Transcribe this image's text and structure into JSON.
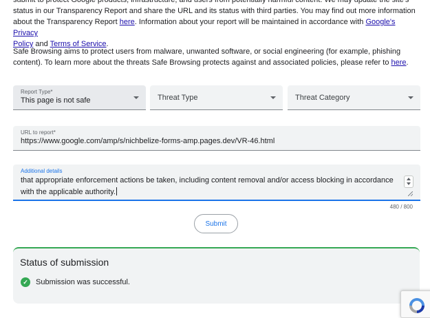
{
  "intro": {
    "line1": "submit to protect Google products, infrastructure, and users from potentially harmful content. We may update the site's",
    "line2": "status in our Transparency Report and share the URL and its status with third parties. You may find out more information",
    "line3_before": "about the Transparency Report ",
    "line3_link": "here",
    "line3_after": ". Information about your report will be maintained in accordance with ",
    "privacy_link_1": "Google's Privacy",
    "privacy_link_2": "Policy",
    "and": " and ",
    "terms_link": "Terms of Service",
    "period": "."
  },
  "safe_browsing": {
    "line1": "Safe Browsing aims to protect users from malware, unwanted software, or social engineering (for example, phishing",
    "line2_before": "content). To learn more about the threats Safe Browsing protects against and associated policies, please refer to ",
    "line2_link": "here",
    "line2_after": "."
  },
  "form": {
    "report_type_label": "Report Type*",
    "report_type_value": "This page is not safe",
    "threat_type_placeholder": "Threat Type",
    "threat_category_placeholder": "Threat Category",
    "url_label": "URL to report*",
    "url_value": "https://www.google.com/amp/s/nichbelize-forms-amp.pages.dev/VR-46.html",
    "details_label": "Additional details",
    "details_line1": "that appropriate enforcement actions be taken, including content removal and/or access blocking in accordance",
    "details_line2": "with the applicable authority.",
    "char_count": "480 / 800",
    "submit_label": "Submit"
  },
  "status": {
    "title": "Status of submission",
    "message": "Submission was successful.",
    "icon": "check-circle-icon"
  },
  "icons": {
    "dropdown": "chevron-down-icon",
    "recaptcha": "recaptcha-icon"
  },
  "colors": {
    "link": "#1a0dab",
    "accent": "#1a73e8",
    "success": "#34a853"
  }
}
